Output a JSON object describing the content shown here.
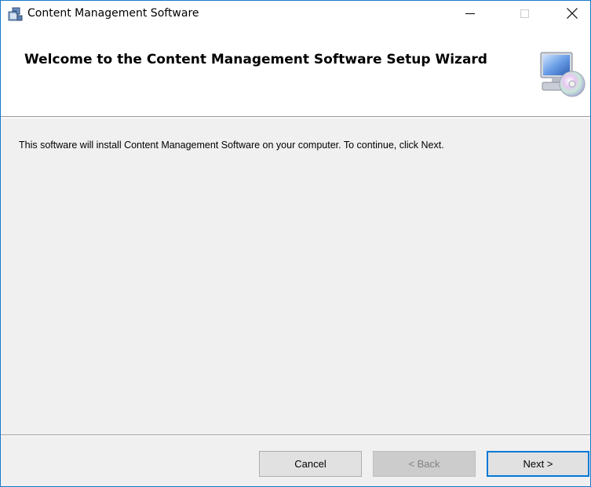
{
  "window": {
    "title": "Content Management Software",
    "minimize_icon": "minimize-icon",
    "maximize_icon": "maximize-icon",
    "close_icon": "close-icon",
    "app_icon": "installer-package-icon"
  },
  "header": {
    "title": "Welcome to the Content Management Software Setup Wizard",
    "graphic_icon": "computer-cd-icon"
  },
  "content": {
    "message": "This software will install Content Management Software on your computer. To continue, click Next."
  },
  "buttons": {
    "cancel": "Cancel",
    "back": "< Back",
    "next": "Next >"
  },
  "colors": {
    "window_border": "#1979ca",
    "focus_border": "#0078d7",
    "panel_background": "#f0f0f0"
  }
}
